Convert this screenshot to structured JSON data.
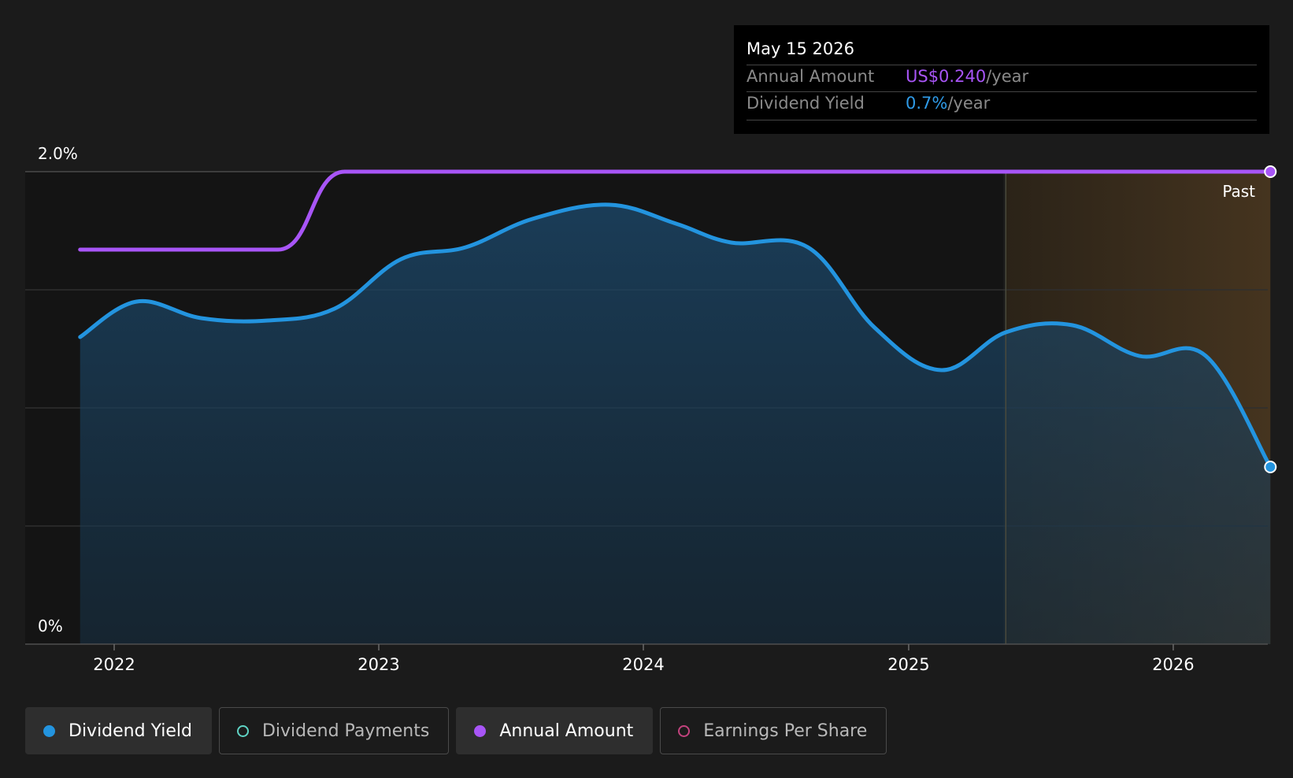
{
  "tooltip": {
    "date": "May 15 2026",
    "rows": [
      {
        "label": "Annual Amount",
        "value": "US$0.240",
        "unit": "/year",
        "color": "#a855f7"
      },
      {
        "label": "Dividend Yield",
        "value": "0.7%",
        "unit": "/year",
        "color": "#2f9be8"
      }
    ]
  },
  "legend": [
    {
      "label": "Dividend Yield",
      "active": true,
      "color": "#2394df",
      "marker": "filled"
    },
    {
      "label": "Dividend Payments",
      "active": false,
      "color": "#5fd3c4",
      "marker": "hollow"
    },
    {
      "label": "Annual Amount",
      "active": true,
      "color": "#a855f7",
      "marker": "filled"
    },
    {
      "label": "Earnings Per Share",
      "active": false,
      "color": "#c2427d",
      "marker": "hollow"
    }
  ],
  "chart_data": {
    "type": "line",
    "y_axis": {
      "min": 0,
      "max": 2.0,
      "labels": [
        "2.0%",
        "0%"
      ],
      "gridlines": [
        0,
        0.5,
        1.0,
        1.5,
        2.0
      ]
    },
    "x_axis": {
      "labels": [
        "2022",
        "2023",
        "2024",
        "2025",
        "2026"
      ],
      "range": [
        "2021-11-15",
        "2026-05-15"
      ]
    },
    "forecast_label": "Past",
    "forecast_start": "2025-05-15",
    "series": [
      {
        "name": "Dividend Yield",
        "color": "#2394df",
        "unit": "%",
        "points": [
          [
            "2021-11-15",
            1.3
          ],
          [
            "2022-02-01",
            1.45
          ],
          [
            "2022-05-01",
            1.38
          ],
          [
            "2022-08-01",
            1.37
          ],
          [
            "2022-11-01",
            1.42
          ],
          [
            "2023-02-01",
            1.63
          ],
          [
            "2023-05-01",
            1.68
          ],
          [
            "2023-08-01",
            1.8
          ],
          [
            "2023-11-15",
            1.86
          ],
          [
            "2024-02-15",
            1.78
          ],
          [
            "2024-05-01",
            1.7
          ],
          [
            "2024-08-15",
            1.68
          ],
          [
            "2024-11-15",
            1.34
          ],
          [
            "2025-02-15",
            1.16
          ],
          [
            "2025-05-15",
            1.32
          ],
          [
            "2025-08-15",
            1.35
          ],
          [
            "2025-11-15",
            1.22
          ],
          [
            "2026-02-15",
            1.22
          ],
          [
            "2026-05-15",
            0.75
          ]
        ]
      },
      {
        "name": "Annual Amount",
        "color": "#a855f7",
        "points": [
          [
            "2021-11-15",
            1.67
          ],
          [
            "2022-08-15",
            1.67
          ],
          [
            "2022-11-15",
            2.0
          ],
          [
            "2026-05-15",
            2.0
          ]
        ]
      }
    ]
  }
}
